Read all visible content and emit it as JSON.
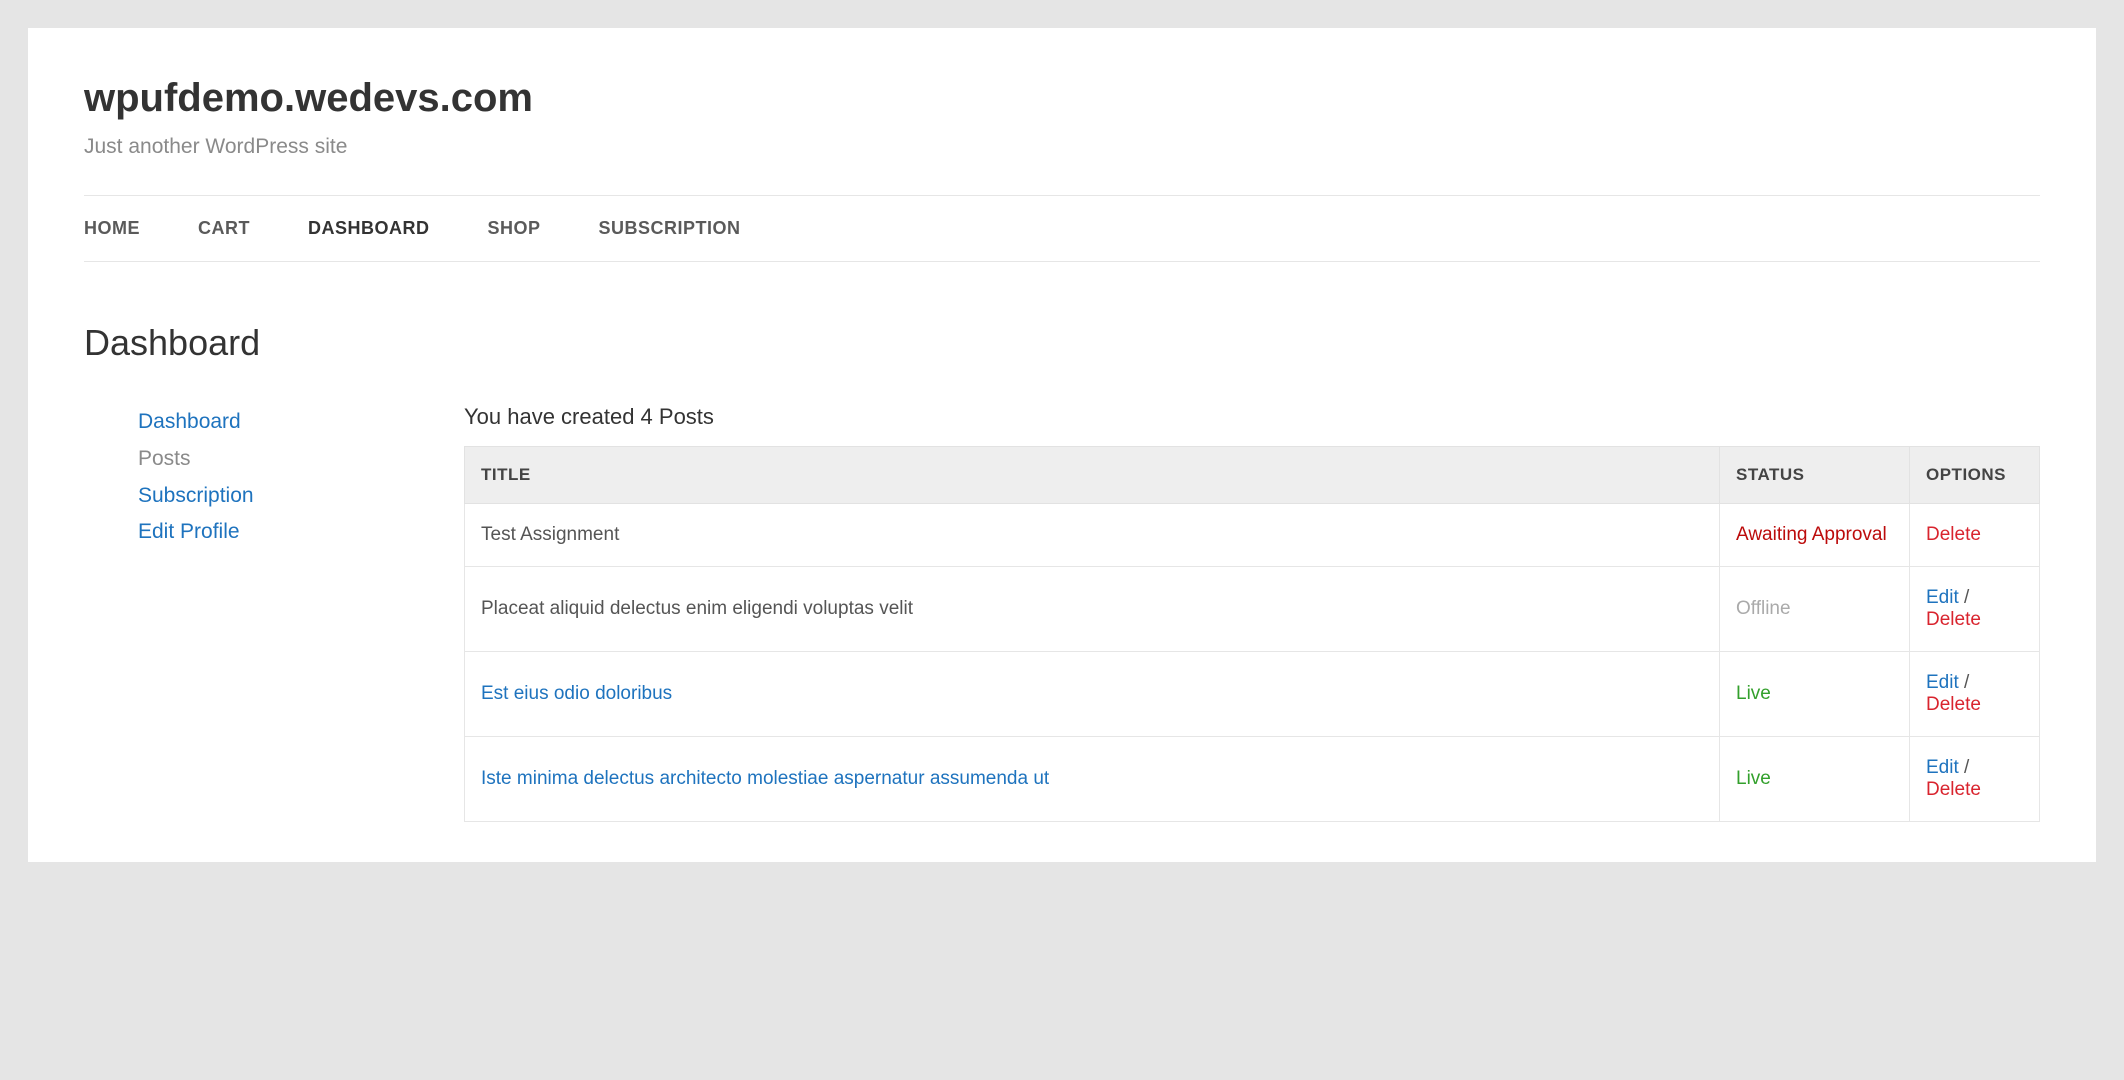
{
  "site": {
    "title": "wpufdemo.wedevs.com",
    "description": "Just another WordPress site"
  },
  "nav": {
    "items": [
      {
        "label": "HOME",
        "active": false
      },
      {
        "label": "CART",
        "active": false
      },
      {
        "label": "DASHBOARD",
        "active": true
      },
      {
        "label": "SHOP",
        "active": false
      },
      {
        "label": "SUBSCRIPTION",
        "active": false
      }
    ]
  },
  "page": {
    "title": "Dashboard"
  },
  "dash_nav": {
    "items": [
      {
        "label": "Dashboard",
        "current": false
      },
      {
        "label": "Posts",
        "current": true
      },
      {
        "label": "Subscription",
        "current": false
      },
      {
        "label": "Edit Profile",
        "current": false
      }
    ]
  },
  "posts_section": {
    "heading": "You have created 4 Posts",
    "columns": {
      "title": "TITLE",
      "status": "STATUS",
      "options": "OPTIONS"
    },
    "option_labels": {
      "edit": "Edit",
      "delete": "Delete",
      "sep": " / "
    },
    "rows": [
      {
        "title": "Test Assignment",
        "title_link": false,
        "status": "Awaiting Approval",
        "status_kind": "awaiting",
        "can_edit": false,
        "can_delete": true
      },
      {
        "title": "Placeat aliquid delectus enim eligendi voluptas velit",
        "title_link": false,
        "status": "Offline",
        "status_kind": "offline",
        "can_edit": true,
        "can_delete": true
      },
      {
        "title": "Est eius odio doloribus",
        "title_link": true,
        "status": "Live",
        "status_kind": "live",
        "can_edit": true,
        "can_delete": true
      },
      {
        "title": "Iste minima delectus architecto molestiae aspernatur assumenda ut",
        "title_link": true,
        "status": "Live",
        "status_kind": "live",
        "can_edit": true,
        "can_delete": true
      }
    ]
  }
}
